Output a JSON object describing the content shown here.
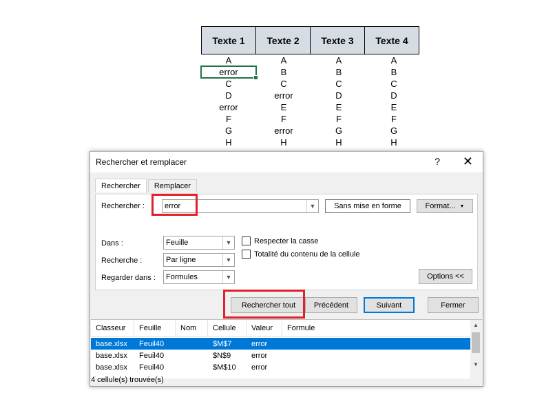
{
  "sheet": {
    "headers": [
      "Texte 1",
      "Texte 2",
      "Texte 3",
      "Texte 4"
    ],
    "rows": [
      [
        "A",
        "A",
        "A",
        "A"
      ],
      [
        "error",
        "B",
        "B",
        "B"
      ],
      [
        "C",
        "C",
        "C",
        "C"
      ],
      [
        "D",
        "error",
        "D",
        "D"
      ],
      [
        "error",
        "E",
        "E",
        "E"
      ],
      [
        "F",
        "F",
        "F",
        "F"
      ],
      [
        "G",
        "error",
        "G",
        "G"
      ],
      [
        "H",
        "H",
        "H",
        "H"
      ]
    ]
  },
  "dialog": {
    "title": "Rechercher et remplacer",
    "help": "?",
    "close": "✕",
    "tabs": [
      "Rechercher",
      "Remplacer"
    ],
    "search_label": "Rechercher :",
    "search_value": "error",
    "no_format_label": "Sans mise en forme",
    "format_label": "Format...",
    "dans_label": "Dans :",
    "dans_value": "Feuille",
    "recherche_label": "Recherche :",
    "recherche_value": "Par ligne",
    "regarder_label": "Regarder dans :",
    "regarder_value": "Formules",
    "match_case_label": "Respecter la casse",
    "entire_cell_label": "Totalité du contenu de la cellule",
    "options_label": "Options <<",
    "find_all_label": "Rechercher tout",
    "previous_label": "Précédent",
    "next_label": "Suivant",
    "close_label": "Fermer"
  },
  "results": {
    "columns": [
      "Classeur",
      "Feuille",
      "Nom",
      "Cellule",
      "Valeur",
      "Formule"
    ],
    "rows": [
      [
        "base.xlsx",
        "Feuil40",
        "",
        "$M$7",
        "error",
        ""
      ],
      [
        "base.xlsx",
        "Feuil40",
        "",
        "$N$9",
        "error",
        ""
      ],
      [
        "base.xlsx",
        "Feuil40",
        "",
        "$M$10",
        "error",
        ""
      ]
    ],
    "status": "4 cellule(s) trouvée(s)"
  },
  "colors": {
    "accent": "#0078d7",
    "highlight": "#e0202a",
    "header_fill": "#d6dce4",
    "excel_green": "#217346"
  }
}
